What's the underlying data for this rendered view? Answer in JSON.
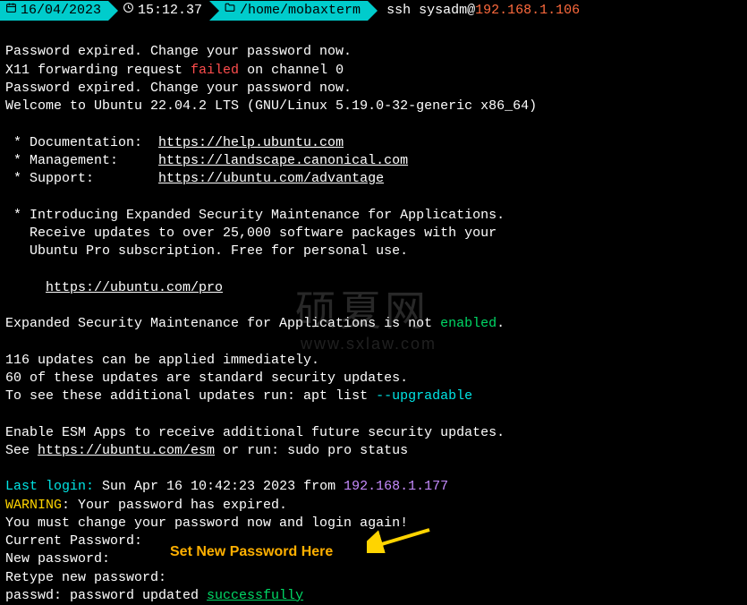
{
  "statusbar": {
    "date": "16/04/2023",
    "time": "15:12.37",
    "cwd": "/home/mobaxterm",
    "cmd_prefix": "ssh sysadm@",
    "cmd_ip": "192.168.1.106"
  },
  "term": {
    "l1a": "Password expired. Change your password now.",
    "l2a": "X11 forwarding request ",
    "l2b": "failed",
    "l2c": " on channel 0",
    "l3": "Password expired. Change your password now.",
    "l4": "Welcome to Ubuntu 22.04.2 LTS (GNU/Linux 5.19.0-32-generic x86_64)",
    "doc_label": " * Documentation:  ",
    "doc_link": "https://help.ubuntu.com",
    "mgmt_label": " * Management:     ",
    "mgmt_link": "https://landscape.canonical.com",
    "sup_label": " * Support:        ",
    "sup_link": "https://ubuntu.com/advantage",
    "esm1": " * Introducing Expanded Security Maintenance for Applications.",
    "esm2": "   Receive updates to over 25,000 software packages with your",
    "esm3": "   Ubuntu Pro subscription. Free for personal use.",
    "esm_link_pad": "     ",
    "esm_link": "https://ubuntu.com/pro",
    "exp1": "Expanded Security Maintenance for Applications is not ",
    "exp1b": "enabled",
    "exp1c": ".",
    "upd1": "116 updates can be applied immediately.",
    "upd2": "60 of these updates are standard security updates.",
    "upd3a": "To see these additional updates run: apt list ",
    "upd3b": "--upgradable",
    "esmapp1": "Enable ESM Apps to receive additional future security updates.",
    "esmapp2a": "See ",
    "esmapp2b": "https://ubuntu.com/esm",
    "esmapp2c": " or run: sudo pro status",
    "last_label": "Last login:",
    "last_rest": " Sun Apr 16 10:42:23 2023 from ",
    "last_ip": "192.168.1.177",
    "warn_label": "WARNING",
    "warn_rest": ": Your password has expired.",
    "must": "You must change your password now and login again!",
    "curpwd": "Current Password:",
    "newpwd": "New password:",
    "retype": "Retype new password:",
    "passwd_a": "passwd: password updated ",
    "passwd_b": "successfully"
  },
  "annotation": "Set New Password Here",
  "watermark1": "硕夏网",
  "watermark2": "www.sxlaw.com"
}
